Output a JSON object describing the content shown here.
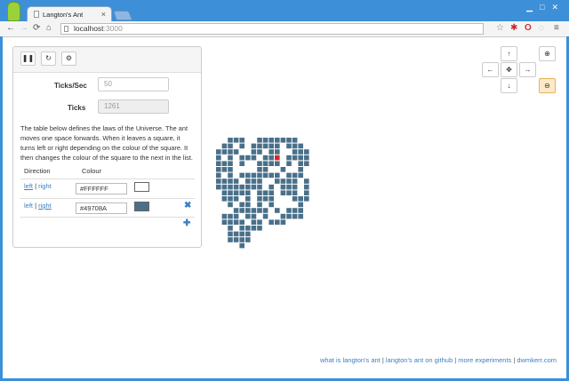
{
  "browser": {
    "tab_title": "Langton's Ant",
    "tab_close": "×",
    "url_host": "localhost",
    "url_port": ":3000"
  },
  "controls": {
    "pause_icon": "pause-icon",
    "reset_icon": "refresh-icon",
    "settings_icon": "gear-icon"
  },
  "form": {
    "ticks_per_sec_label": "Ticks/Sec",
    "ticks_per_sec_value": "50",
    "ticks_label": "Ticks",
    "ticks_value": "1261"
  },
  "description": "The table below defines the laws of the Universe. The ant moves one space forwards. When it leaves a square, it turns left or right depending on the colour of the square. It then changes the colour of the square to the next in the list.",
  "rules": {
    "headers": [
      "Direction",
      "Colour"
    ],
    "rows": [
      {
        "left": "left",
        "sep": " | ",
        "right": "right",
        "colour": "#FFFFFF",
        "swatch": "#FFFFFF",
        "remove": false
      },
      {
        "left": "left",
        "sep": " | ",
        "right": "right",
        "colour": "#49708A",
        "swatch": "#49708A",
        "remove": true
      }
    ],
    "add_icon": "plus-icon",
    "remove_icon": "remove-icon"
  },
  "viewport": {
    "pan_up_icon": "arrow-up-icon",
    "pan_down_icon": "arrow-down-icon",
    "pan_left_icon": "arrow-left-icon",
    "pan_right_icon": "arrow-right-icon",
    "center_icon": "move-icon",
    "zoom_in_icon": "zoom-in-icon",
    "zoom_out_icon": "zoom-out-icon"
  },
  "grid": {
    "cell_color": "#49708A",
    "ant_color": "#d9262c",
    "ant_cell": [
      9,
      3
    ],
    "rows": [
      "..XXX..XXXXXXX....",
      ".XX.X.XXXXX.XXX...",
      "XXXX..XX.XX..XXX..",
      "X.X.XXX.XXA.XXXX..",
      "XXX.X..XXXX.X.XX..",
      "XXX....XX..X..X...",
      "X.X.XXXXXXX.XXX...",
      "XXXX.XXX..XXXX.X..",
      "XXXXXXXX.X.XXX.X..",
      ".XXXXX.XXX.XXX.X..",
      ".XXX.X.XXX...XXX..",
      "..X.XX.X.X....X...",
      "...XXXXXX.X.XXX...",
      ".XXX.XX.X..XXXX...",
      ".XXXX.XX.XXX.......",
      "..X.XXXX...........",
      "..XXXX.............",
      "..XXXX.............",
      "....X.............."
    ]
  },
  "footer": {
    "link1": "what is langton's ant",
    "link2": "langton's ant on github",
    "link3": "more experiments",
    "link4": "dwmkerr.com",
    "sep": " | "
  }
}
